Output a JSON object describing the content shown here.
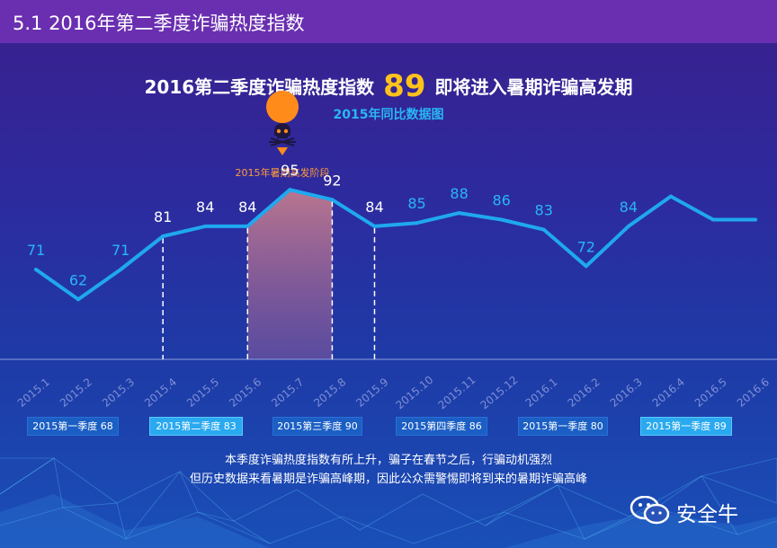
{
  "header": {
    "title": "5.1 2016年第二季度诈骗热度指数"
  },
  "headline": {
    "prefix": "2016第二季度诈骗热度指数",
    "score": "89",
    "suffix": "即将进入暑期诈骗高发期"
  },
  "subtitle": "2015年同比数据图",
  "annotation": {
    "label": "2015年暑期高发阶段",
    "icon": "skull-icon"
  },
  "quarters": [
    {
      "label": "2015第一季度 68",
      "style": "dark"
    },
    {
      "label": "2015第二季度 83",
      "style": "light"
    },
    {
      "label": "2015第三季度 90",
      "style": "dark"
    },
    {
      "label": "2015第四季度 86",
      "style": "dark"
    },
    {
      "label": "2015第一季度 80",
      "style": "dark"
    },
    {
      "label": "2015第一季度 89",
      "style": "light"
    }
  ],
  "footnote": {
    "line1": "本季度诈骗热度指数有所上升，骗子在春节之后，行骗动机强烈",
    "line2": "但历史数据来看暑期是诈骗高峰期，因此公众需警惕即将到来的暑期诈骗高峰"
  },
  "brand": {
    "name": "安全牛",
    "icon": "wechat-icon"
  },
  "colors": {
    "line": "#1fa8ef",
    "highlight": "#ff8c1a",
    "score": "#ffc21a",
    "header": "#6a2fb0"
  },
  "chart_data": {
    "type": "line",
    "categories": [
      "2015.1",
      "2015.2",
      "2015.3",
      "2015.4",
      "2015.5",
      "2015.6",
      "2015.7",
      "2015.8",
      "2015.9",
      "2015.10",
      "2015.11",
      "2015.12",
      "2016.1",
      "2016.2",
      "2016.3",
      "2016.4",
      "2016.5",
      "2016.6"
    ],
    "values": [
      71,
      62,
      71,
      81,
      84,
      84,
      95,
      92,
      84,
      85,
      88,
      86,
      83,
      72,
      84,
      93,
      86,
      86
    ],
    "labels": [
      "71",
      "62",
      "71",
      "81",
      "84",
      "84",
      "95",
      "92",
      "84",
      "85",
      "88",
      "86",
      "83",
      "72",
      "84",
      "",
      "",
      ""
    ],
    "white_labels": [
      3,
      4,
      5,
      6,
      7,
      8
    ],
    "dashed_at": [
      3,
      5,
      7,
      8
    ],
    "highlight_range": [
      5,
      7
    ],
    "ylim": [
      40,
      110
    ],
    "grid": false,
    "legend": "none"
  }
}
